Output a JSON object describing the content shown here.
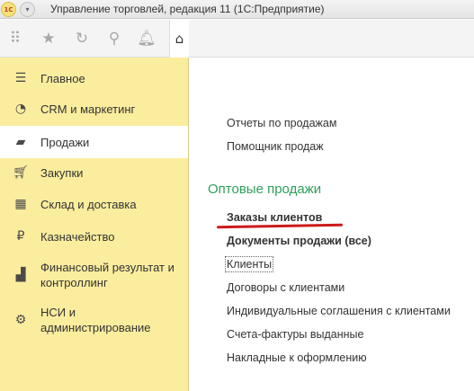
{
  "window": {
    "logo_text": "1С",
    "menu_arrow": "▾",
    "title": "Управление торговлей, редакция 11  (1С:Предприятие)"
  },
  "toolbar": {
    "icons": [
      "apps-grid-icon",
      "star-icon",
      "history-icon",
      "search-icon",
      "bell-icon",
      "home-icon"
    ],
    "glyphs": {
      "grid": "⠿",
      "star": "★",
      "history": "↻",
      "search": "⚲",
      "bell": "🔔︎",
      "home": "⌂"
    }
  },
  "sidebar": {
    "items": [
      {
        "label": "Главное",
        "icon": "menu-lines-icon",
        "glyph": "☰"
      },
      {
        "label": "CRM и маркетинг",
        "icon": "pie-chart-icon",
        "glyph": "◔"
      },
      {
        "label": "Продажи",
        "icon": "shopping-bag-icon",
        "glyph": "▰"
      },
      {
        "label": "Закупки",
        "icon": "shopping-cart-icon",
        "glyph": "🛒︎"
      },
      {
        "label": "Склад и доставка",
        "icon": "warehouse-grid-icon",
        "glyph": "▦"
      },
      {
        "label": "Казначейство",
        "icon": "ruble-coin-icon",
        "glyph": "₽"
      },
      {
        "label": "Финансовый результат и контроллинг",
        "icon": "bar-chart-icon",
        "glyph": "▟"
      },
      {
        "label": "НСИ и администрирование",
        "icon": "gear-icon",
        "glyph": "⚙"
      }
    ],
    "active_index": 2
  },
  "main": {
    "top_links": [
      "Отчеты по продажам",
      "Помощник продаж"
    ],
    "section_title": "Оптовые продажи",
    "section_links": [
      "Заказы клиентов",
      "Документы продажи (все)",
      "Клиенты",
      "Договоры с клиентами",
      "Индивидуальные соглашения с клиентами",
      "Счета-фактуры выданные",
      "Накладные к оформлению"
    ]
  },
  "colors": {
    "sidebar_bg": "#fbed9e",
    "section_title": "#2ea05a",
    "annotation_underline": "#cc1a1a"
  }
}
